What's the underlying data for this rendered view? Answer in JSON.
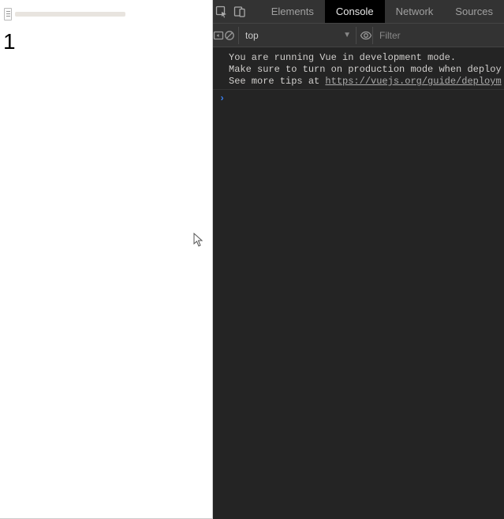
{
  "page": {
    "counter": "1"
  },
  "devtools": {
    "tabs": {
      "elements": "Elements",
      "console": "Console",
      "network": "Network",
      "sources": "Sources"
    },
    "toolbar": {
      "context": "top",
      "filter_placeholder": "Filter"
    },
    "log": {
      "line1": "You are running Vue in development mode.",
      "line2": "Make sure to turn on production mode when deploy",
      "line3_prefix": "See more tips at ",
      "line3_link": "https://vuejs.org/guide/deploym"
    },
    "prompt": "›"
  }
}
